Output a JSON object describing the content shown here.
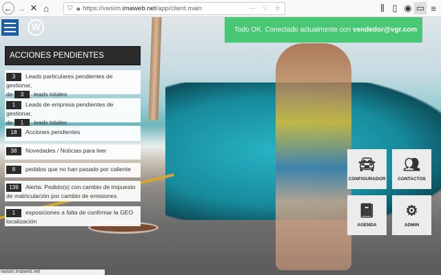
{
  "browser": {
    "url_prefix": "https://vwsim.",
    "url_host": "imaweb.net",
    "url_path": "/app/client.main",
    "status_text": "vwsim.imaweb.net"
  },
  "notification": {
    "text": "Todo OK. Conectado actualmente con",
    "user": "vendedor@vgr.com"
  },
  "panel": {
    "title": "ACCIONES PENDIENTES",
    "items": [
      {
        "count": "3",
        "text": "Leads particulares pendientes de gestionar,",
        "prefix": "de",
        "total": "3",
        "suffix": "leads totales"
      },
      {
        "count": "1",
        "text": "Leads de empresa pendientes de gestionar,",
        "prefix": "de",
        "total": "1",
        "suffix": "leads totales"
      },
      {
        "count": "18",
        "text": "Acciones pendientes"
      },
      {
        "count": "38",
        "text": "Novedades / Noticias para leer"
      },
      {
        "count": "8",
        "text": "pedidos que no han pasado por caliente"
      },
      {
        "count": "139",
        "text": "Alerta: Pedido(s) con cambio de impuesto de matriculación por cambio de emisiones"
      },
      {
        "count": "1",
        "text": "exposiciones a falta de confirmar la GEO localización"
      }
    ]
  },
  "tiles": [
    {
      "label": "CONFIGURADOR",
      "icon": "car-hand-icon"
    },
    {
      "label": "CONTACTOS",
      "icon": "people-icon"
    },
    {
      "label": "AGENDA",
      "icon": "notebook-icon"
    },
    {
      "label": "ADMIN",
      "icon": "gears-icon"
    }
  ],
  "colors": {
    "toast": "#48c774",
    "menu": "#1c5fa6",
    "panel": "#2b2b2b"
  }
}
